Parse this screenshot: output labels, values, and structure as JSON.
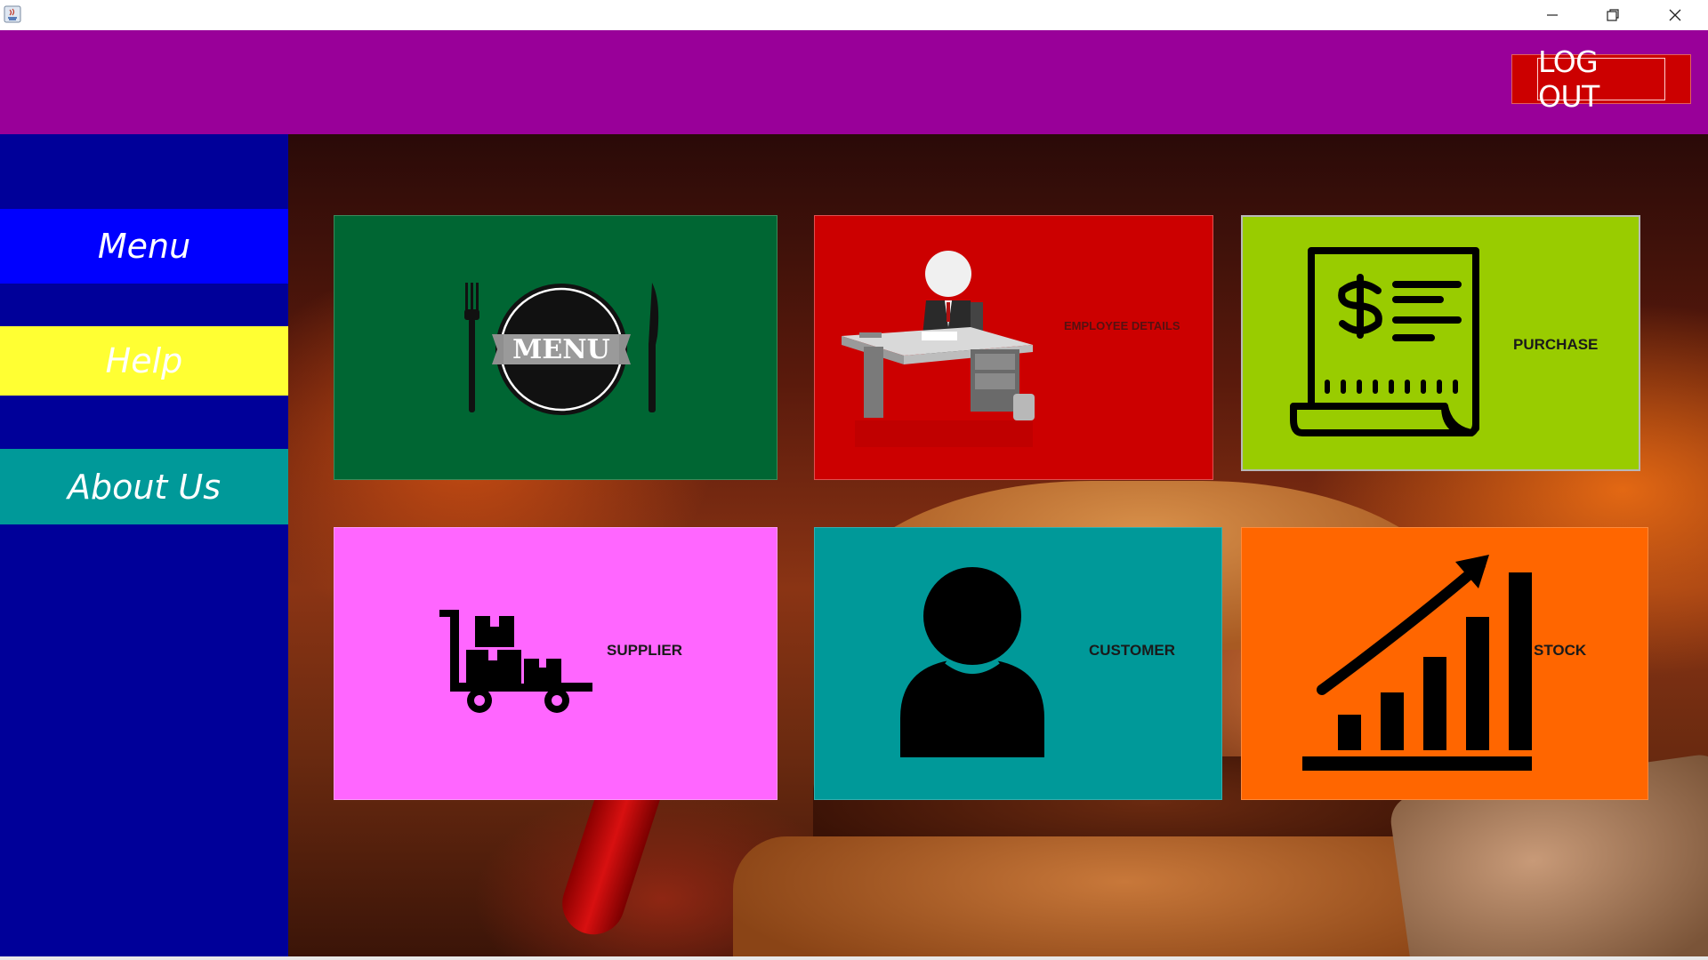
{
  "window": {
    "controls": {
      "minimize_icon": "minimize-icon",
      "restore_icon": "restore-icon",
      "close_icon": "close-icon"
    }
  },
  "header": {
    "logout_label": "LOG OUT",
    "color": "#990099"
  },
  "sidebar": {
    "items": [
      {
        "label": "Menu",
        "color": "#0000ff"
      },
      {
        "label": "Help",
        "color": "#ffff33"
      },
      {
        "label": "About Us",
        "color": "#009999"
      }
    ],
    "background": "#000099"
  },
  "tiles": {
    "menu": {
      "badge_text": "MENU",
      "color": "#006633",
      "icon": "menu-plate-icon"
    },
    "employee": {
      "label": "EMPLOYEE DETAILS",
      "color": "#cc0000",
      "icon": "employee-desk-icon"
    },
    "purchase": {
      "label": "PURCHASE",
      "color": "#99cc00",
      "icon": "receipt-icon"
    },
    "supplier": {
      "label": "SUPPLIER",
      "color": "#ff66ff",
      "icon": "hand-truck-icon"
    },
    "customer": {
      "label": "CUSTOMER",
      "color": "#009999",
      "icon": "person-icon"
    },
    "stock": {
      "label": "STOCK",
      "color": "#ff6600",
      "icon": "growth-chart-icon"
    }
  }
}
